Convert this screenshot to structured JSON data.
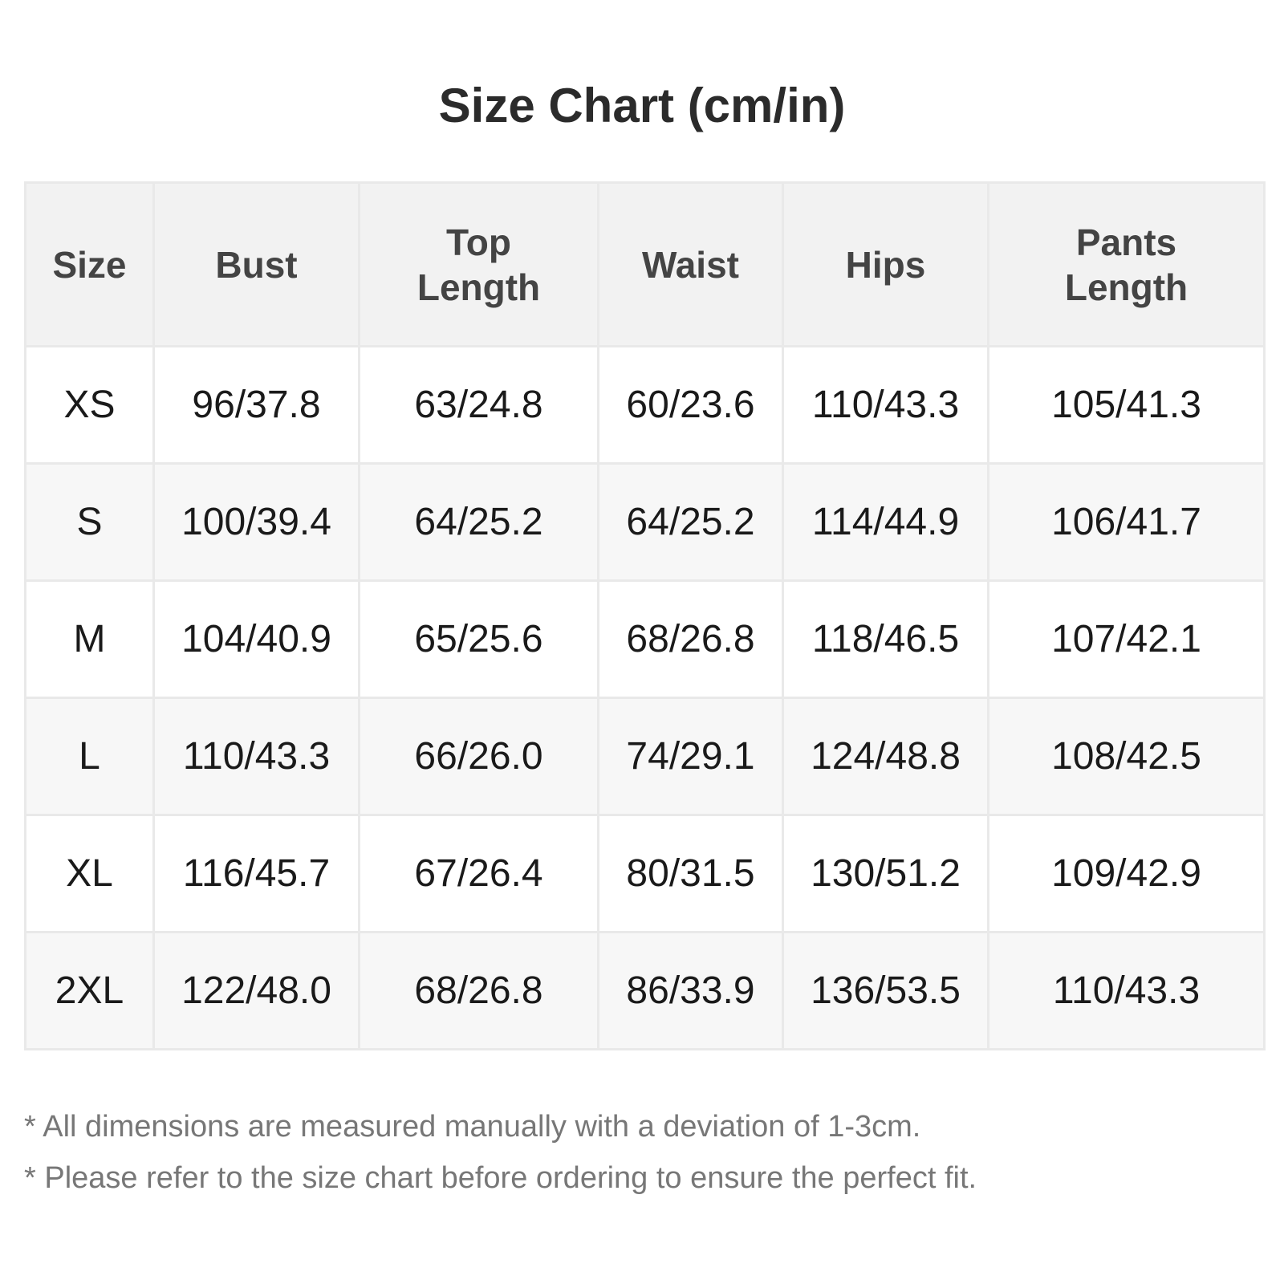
{
  "title": "Size Chart (cm/in)",
  "table": {
    "headers": [
      "Size",
      "Bust",
      "Top Length",
      "Waist",
      "Hips",
      "Pants Length"
    ],
    "rows": [
      [
        "XS",
        "96/37.8",
        "63/24.8",
        "60/23.6",
        "110/43.3",
        "105/41.3"
      ],
      [
        "S",
        "100/39.4",
        "64/25.2",
        "64/25.2",
        "114/44.9",
        "106/41.7"
      ],
      [
        "M",
        "104/40.9",
        "65/25.6",
        "68/26.8",
        "118/46.5",
        "107/42.1"
      ],
      [
        "L",
        "110/43.3",
        "66/26.0",
        "74/29.1",
        "124/48.8",
        "108/42.5"
      ],
      [
        "XL",
        "116/45.7",
        "67/26.4",
        "80/31.5",
        "130/51.2",
        "109/42.9"
      ],
      [
        "2XL",
        "122/48.0",
        "68/26.8",
        "86/33.9",
        "136/53.5",
        "110/43.3"
      ]
    ]
  },
  "notes": [
    "* All dimensions are measured manually with a deviation of 1-3cm.",
    "* Please refer to the size chart before ordering to ensure the perfect fit."
  ]
}
